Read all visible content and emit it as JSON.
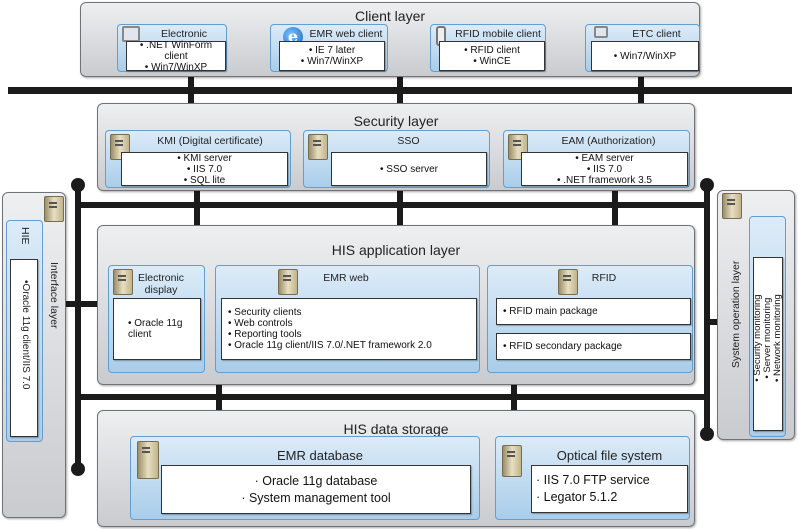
{
  "client_layer": {
    "title": "Client layer",
    "items": [
      {
        "title": "Electronic display client",
        "lines": [
          "• .NET WinForm client",
          "• Win7/WinXP"
        ],
        "icon": "monitor-icon"
      },
      {
        "title": "EMR web client",
        "lines": [
          "• IE 7 later",
          "• Win7/WinXP"
        ],
        "icon": "internet-explorer-icon"
      },
      {
        "title": "RFID mobile client",
        "lines": [
          "• RFID client",
          "• WinCE"
        ],
        "icon": "mobile-device-icon"
      },
      {
        "title": "ETC client",
        "lines": [
          "• Win7/WinXP"
        ],
        "icon": "desktop-pc-icon"
      }
    ]
  },
  "security_layer": {
    "title": "Security layer",
    "items": [
      {
        "title": "KMI (Digital certificate)",
        "lines": [
          "• KMI server",
          "• IIS 7.0",
          "• SQL lite"
        ]
      },
      {
        "title": "SSO",
        "lines": [
          "• SSO server"
        ]
      },
      {
        "title": "EAM (Authorization)",
        "lines": [
          "• EAM server",
          "• IIS 7.0",
          "• .NET framework 3.5"
        ]
      }
    ]
  },
  "app_layer": {
    "title": "HIS application layer",
    "items": [
      {
        "title": "Electronic display",
        "lines": [
          "• Oracle 11g client"
        ]
      },
      {
        "title": "EMR web",
        "lines": [
          "• Security clients",
          "• Web controls",
          "• Reporting tools",
          "• Oracle 11g client/IIS 7.0/.NET framework 2.0"
        ]
      },
      {
        "title": "RFID",
        "lines": [
          "• RFID main package",
          "• RFID secondary package"
        ]
      }
    ]
  },
  "data_storage": {
    "title": "HIS data storage",
    "items": [
      {
        "title": "EMR database",
        "lines": [
          "· Oracle 11g database",
          "· System management tool"
        ]
      },
      {
        "title": "Optical file system",
        "lines": [
          "· IIS 7.0 FTP service",
          "· Legator 5.1.2"
        ]
      }
    ]
  },
  "interface_layer": {
    "title": "Interface layer",
    "box_title": "HIE",
    "lines": [
      "•Oracle 11g client/IIS 7.0"
    ]
  },
  "system_operation_layer": {
    "title": "System operation layer",
    "lines": [
      "• Security monitoring",
      "• Server monitoring",
      "• Network monitoring"
    ]
  },
  "colors": {
    "bus": "#1b1b1b",
    "layer": "#d8dadd",
    "component": "#b8d6ee",
    "component_border": "#5f9fd3"
  }
}
